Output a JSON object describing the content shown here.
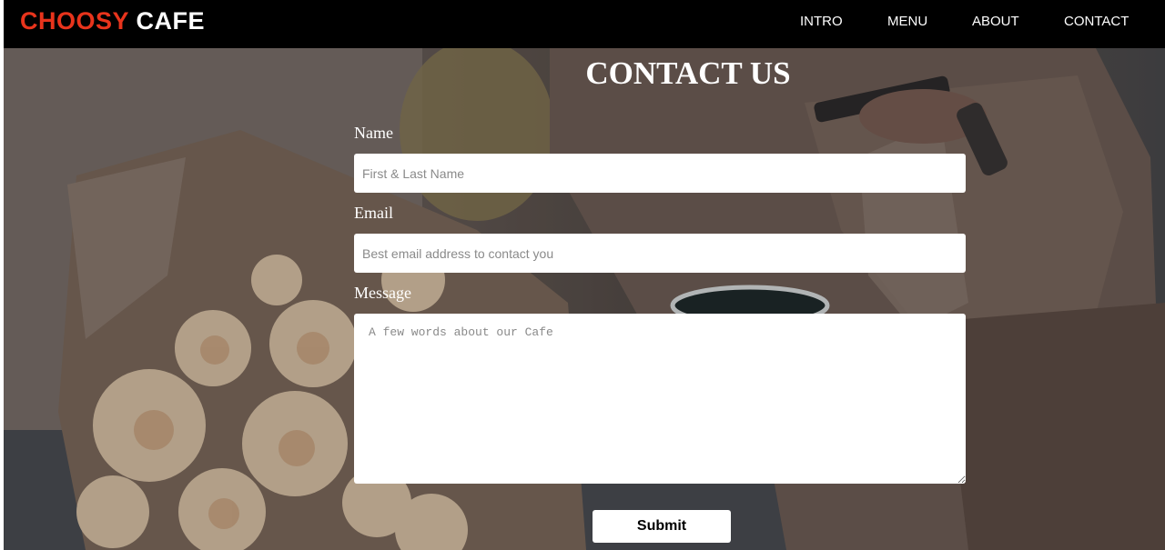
{
  "brand": {
    "part1": "CHOOSY",
    "part2": "CAFE"
  },
  "nav": {
    "items": [
      {
        "label": "INTRO"
      },
      {
        "label": "MENU"
      },
      {
        "label": "ABOUT"
      },
      {
        "label": "CONTACT"
      }
    ]
  },
  "contact": {
    "title": "CONTACT US",
    "name": {
      "label": "Name",
      "placeholder": "First & Last Name"
    },
    "email": {
      "label": "Email",
      "placeholder": "Best email address to contact you"
    },
    "message": {
      "label": "Message",
      "placeholder": "A few words about our Cafe"
    },
    "submit_label": "Submit"
  },
  "colors": {
    "brand_accent": "#e8341c",
    "navbar_bg": "#000000"
  }
}
